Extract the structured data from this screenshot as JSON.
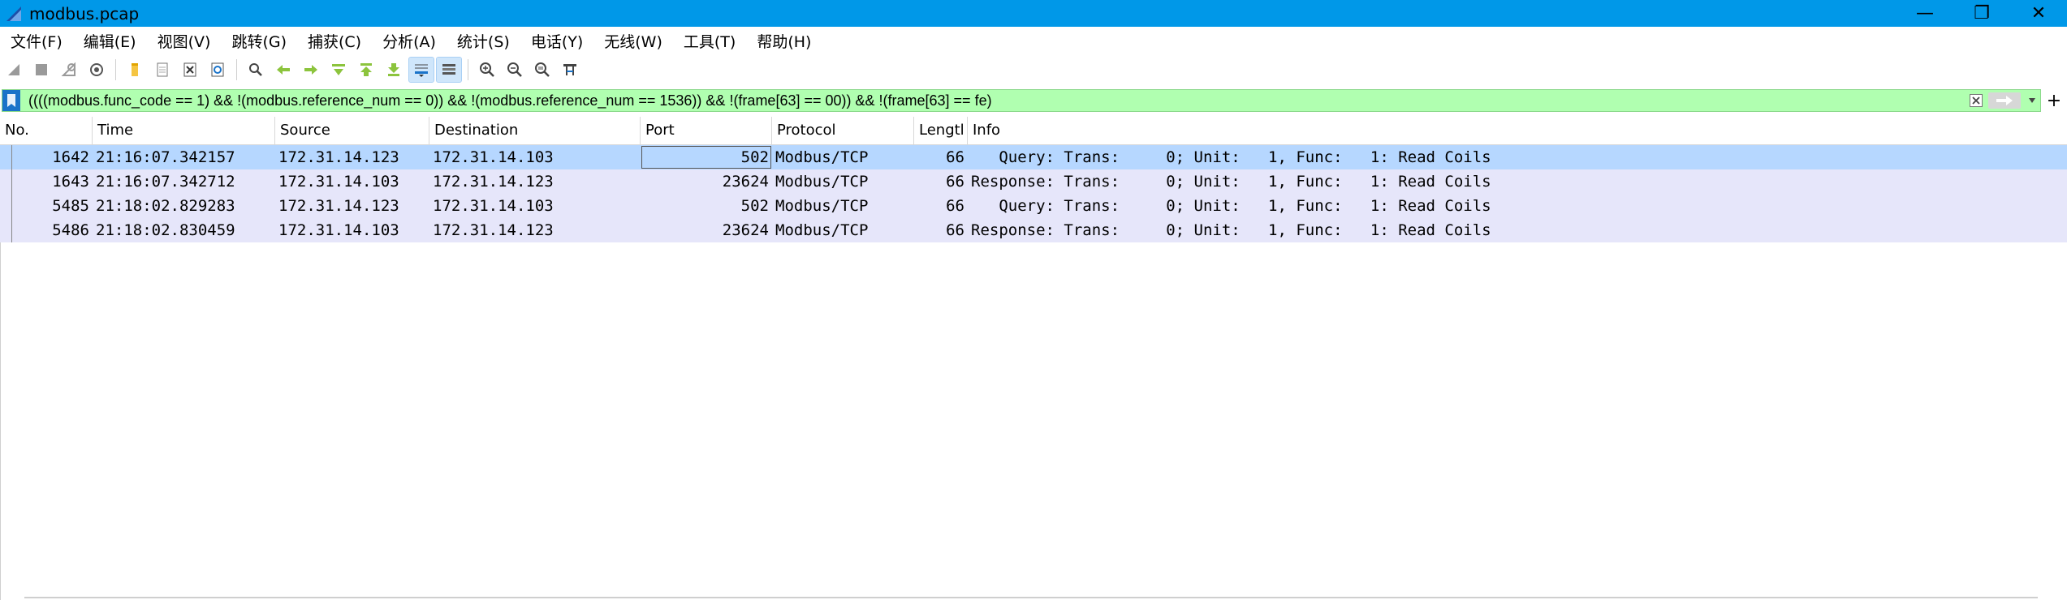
{
  "window": {
    "title": "modbus.pcap",
    "minimize": "—",
    "restore": "❐",
    "close": "✕"
  },
  "menu": [
    "文件(F)",
    "编辑(E)",
    "视图(V)",
    "跳转(G)",
    "捕获(C)",
    "分析(A)",
    "统计(S)",
    "电话(Y)",
    "无线(W)",
    "工具(T)",
    "帮助(H)"
  ],
  "toolbar": {
    "icons": [
      "start-capture-icon",
      "stop-capture-icon",
      "restart-capture-icon",
      "capture-options-icon",
      "open-file-icon",
      "save-file-icon",
      "close-file-icon",
      "reload-file-icon",
      "find-packet-icon",
      "go-back-icon",
      "go-forward-icon",
      "go-to-packet-icon",
      "go-first-icon",
      "go-last-icon",
      "autoscroll-icon",
      "colorize-icon",
      "zoom-in-icon",
      "zoom-out-icon",
      "zoom-normal-icon",
      "resize-columns-icon"
    ]
  },
  "filter": {
    "value": "((((modbus.func_code == 1) && !(modbus.reference_num == 0)) && !(modbus.reference_num == 1536)) && !(frame[63] == 00)) && !(frame[63] == fe)",
    "add_label": "+"
  },
  "columns": [
    "No.",
    "Time",
    "Source",
    "Destination",
    "Port",
    "Protocol",
    "Lengtl",
    "Info"
  ],
  "packets": [
    {
      "no": "1642",
      "time": "21:16:07.342157",
      "src": "172.31.14.123",
      "dst": "172.31.14.103",
      "port": "502",
      "proto": "Modbus/TCP",
      "len": "66",
      "info": "   Query: Trans:     0; Unit:   1, Func:   1: Read Coils"
    },
    {
      "no": "1643",
      "time": "21:16:07.342712",
      "src": "172.31.14.103",
      "dst": "172.31.14.123",
      "port": "23624",
      "proto": "Modbus/TCP",
      "len": "66",
      "info": "Response: Trans:     0; Unit:   1, Func:   1: Read Coils"
    },
    {
      "no": "5485",
      "time": "21:18:02.829283",
      "src": "172.31.14.123",
      "dst": "172.31.14.103",
      "port": "502",
      "proto": "Modbus/TCP",
      "len": "66",
      "info": "   Query: Trans:     0; Unit:   1, Func:   1: Read Coils"
    },
    {
      "no": "5486",
      "time": "21:18:02.830459",
      "src": "172.31.14.103",
      "dst": "172.31.14.123",
      "port": "23624",
      "proto": "Modbus/TCP",
      "len": "66",
      "info": "Response: Trans:     0; Unit:   1, Func:   1: Read Coils"
    }
  ],
  "colors": {
    "titlebar": "#0098e8",
    "filter_bg": "#b0ffb0",
    "row_bg": "#e6e6fa",
    "row_selected": "#b6d7ff"
  }
}
